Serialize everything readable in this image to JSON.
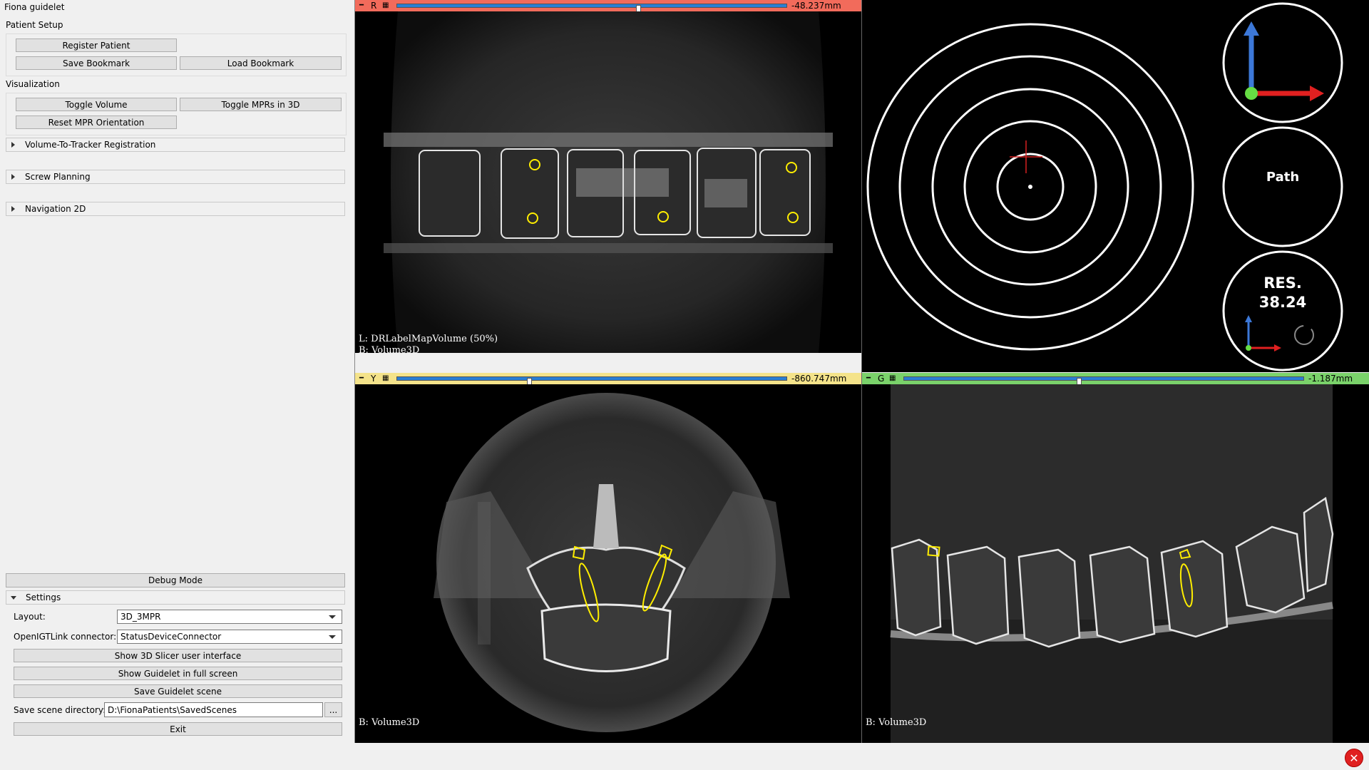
{
  "window": {
    "title": "Fiona guidelet"
  },
  "patient_setup": {
    "label": "Patient Setup",
    "register_label": "Register Patient",
    "save_bookmark_label": "Save Bookmark",
    "load_bookmark_label": "Load Bookmark"
  },
  "visualization": {
    "label": "Visualization",
    "toggle_volume_label": "Toggle Volume",
    "toggle_mprs_label": "Toggle MPRs in 3D",
    "reset_mpr_label": "Reset MPR Orientation"
  },
  "collapsed_sections": [
    {
      "label": "Volume-To-Tracker Registration"
    },
    {
      "label": "Screw Planning"
    },
    {
      "label": "Navigation 2D"
    }
  ],
  "debug_mode_label": "Debug Mode",
  "settings": {
    "label": "Settings",
    "layout_label": "Layout:",
    "layout_value": "3D_3MPR",
    "connector_label": "OpenIGTLink connector:",
    "connector_value": "StatusDeviceConnector",
    "show_slicer_label": "Show 3D Slicer user interface",
    "fullscreen_label": "Show Guidelet in full screen",
    "save_scene_label": "Save Guidelet scene",
    "save_dir_label": "Save scene directory:",
    "save_dir_value": "D:\\FionaPatients\\SavedScenes",
    "browse_label": "...",
    "exit_label": "Exit"
  },
  "views": {
    "red": {
      "letter": "R",
      "offset_value": "-48.237mm",
      "offset_fraction": 0.62,
      "bar_color": "#f26b5b",
      "overlay_line1": "L: DRLabelMapVolume (50%)",
      "overlay_line2": "B: Volume3D"
    },
    "yellow": {
      "letter": "Y",
      "offset_value": "-860.747mm",
      "offset_fraction": 0.34,
      "bar_color": "#f4e38a",
      "overlay_line1": "B: Volume3D"
    },
    "green": {
      "letter": "G",
      "offset_value": "-1.187mm",
      "offset_fraction": 0.44,
      "bar_color": "#7ad26a",
      "overlay_line1": "B: Volume3D"
    }
  },
  "navigation": {
    "path_label": "Path",
    "res_label": "RES.",
    "res_value": "38.24"
  },
  "colors": {
    "red_bar": "#f26b5b",
    "yellow_bar": "#f4e38a",
    "green_bar": "#7ad26a",
    "slider_blue": "#2a7fd4",
    "annotation_yellow": "#ffee00",
    "axis_blue": "#3c78d8",
    "axis_red": "#e02020",
    "axis_green": "#66dd44"
  }
}
